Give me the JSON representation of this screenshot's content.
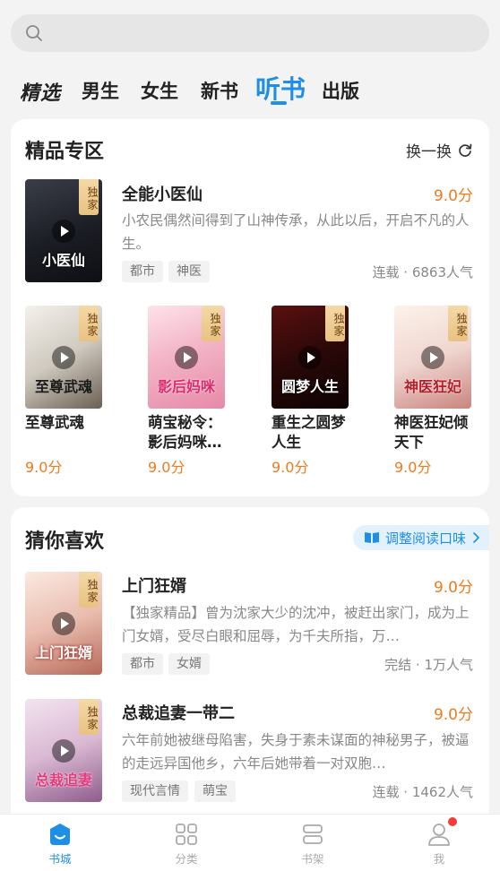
{
  "tabs": [
    "精选",
    "男生",
    "女生",
    "新书",
    "听书",
    "出版"
  ],
  "featured": {
    "title": "精品专区",
    "swap_label": "换一换",
    "main_book": {
      "title": "全能小医仙",
      "score": "9.0分",
      "desc": "小农民偶然间得到了山神传承，从此以后，开启不凡的人生。",
      "tags": [
        "都市",
        "神医"
      ],
      "meta": "连载 · 6863人气",
      "badge": "独家",
      "cover_text": "小医仙"
    },
    "grid": [
      {
        "title": "至尊武魂",
        "score": "9.0分",
        "badge": "独家",
        "cover_text": "至尊武魂"
      },
      {
        "title": "萌宝秘令：影后妈咪…",
        "score": "9.0分",
        "badge": "独家",
        "cover_text": "影后妈咪"
      },
      {
        "title": "重生之圆梦人生",
        "score": "9.0分",
        "badge": "独家",
        "cover_text": "圆梦人生"
      },
      {
        "title": "神医狂妃倾天下",
        "score": "9.0分",
        "badge": "独家",
        "cover_text": "神医狂妃"
      }
    ]
  },
  "guess": {
    "title": "猜你喜欢",
    "adjust_label": "调整阅读口味",
    "books": [
      {
        "title": "上门狂婿",
        "score": "9.0分",
        "desc": "【独家精品】曾为沈家大少的沈冲，被赶出家门，成为上门女婿，受尽白眼和屈辱，为千夫所指，万…",
        "tags": [
          "都市",
          "女婿"
        ],
        "meta": "完结 · 1万人气",
        "badge": "独家",
        "cover_text": "上门狂婿"
      },
      {
        "title": "总裁追妻一带二",
        "score": "9.0分",
        "desc": "六年前她被继母陷害，失身于素未谋面的神秘男子，被逼的走远异国他乡，六年后她带着一对双胞…",
        "tags": [
          "现代言情",
          "萌宝"
        ],
        "meta": "连载 · 1462人气",
        "badge": "独家",
        "cover_text": "总裁追妻"
      }
    ]
  },
  "bottom_nav": [
    "书城",
    "分类",
    "书架",
    "我"
  ],
  "colors": {
    "accent": "#1f8fe6",
    "score": "#f07a1c",
    "badge_bg": "#f0d19a",
    "notify_dot": "#f03c3c"
  }
}
